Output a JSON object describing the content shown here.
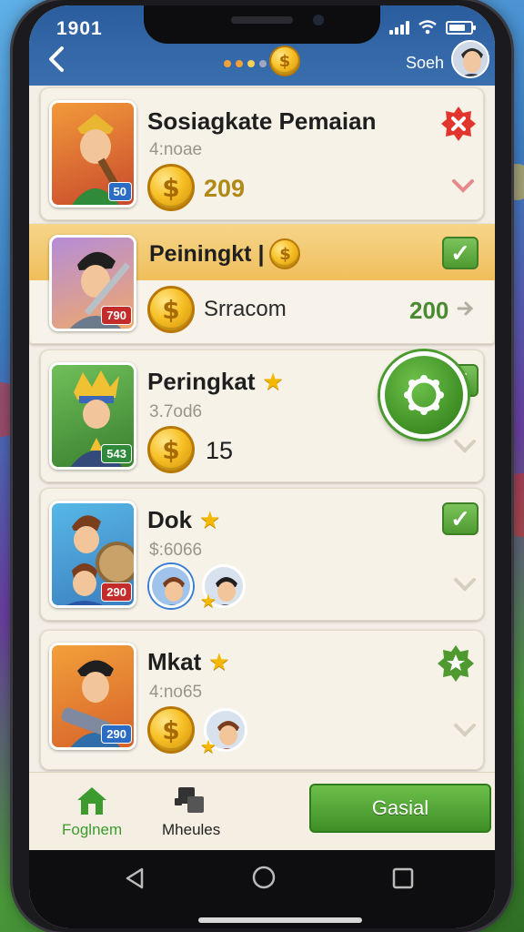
{
  "status_bar": {
    "time": "1901"
  },
  "header": {
    "username": "Soeh",
    "back_icon": "chevron-left-icon",
    "coin_icon": "coin-icon"
  },
  "colors": {
    "header_blue": "#2a5d9e",
    "accent_green": "#4e9a31",
    "coin_gold": "#f7c025",
    "highlight_orange": "#efbf5c"
  },
  "cards": [
    {
      "title": "Sosiagkate Pemaian",
      "subtitle": "4:noae",
      "amount": "209",
      "level_badge": "50",
      "status_icon": "red-close-badge-icon",
      "chevron_icon": "chevron-down-icon"
    },
    {
      "title": "Peiningkt |",
      "label": "Srracom",
      "amount": "200",
      "level_badge": "790",
      "status_icon": "green-check-icon",
      "arrow_icon": "arrow-right-icon"
    },
    {
      "title": "Peringkat",
      "subtitle": "3.7od6",
      "amount": "15",
      "level_badge": "543",
      "status_icon": "green-check-icon",
      "action_icon": "green-round-action-icon"
    },
    {
      "title": "Dok",
      "subtitle": "$:6066",
      "level_badge": "290",
      "status_icon": "green-check-icon"
    },
    {
      "title": "Mkat",
      "subtitle": "4:no65",
      "level_badge": "290",
      "status_icon": "green-star-badge-icon"
    }
  ],
  "bottom_nav": {
    "home_label": "Foglnem",
    "modules_label": "Mheules",
    "action_button": "Gasial"
  }
}
